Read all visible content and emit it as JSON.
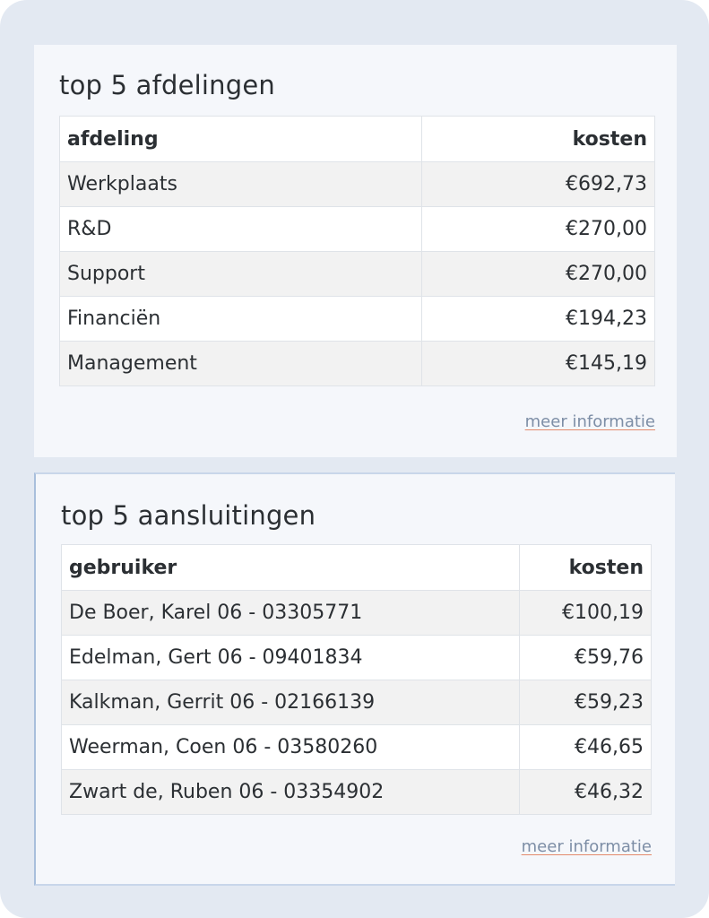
{
  "departments": {
    "title": "top 5 afdelingen",
    "columns": [
      "afdeling",
      "kosten"
    ],
    "rows": [
      {
        "name": "Werkplaats",
        "cost": "€692,73"
      },
      {
        "name": "R&D",
        "cost": "€270,00"
      },
      {
        "name": "Support",
        "cost": "€270,00"
      },
      {
        "name": "Financiën",
        "cost": "€194,23"
      },
      {
        "name": "Management",
        "cost": "€145,19"
      }
    ],
    "more_link": "meer informatie"
  },
  "connections": {
    "title": "top 5 aansluitingen",
    "columns": [
      "gebruiker",
      "kosten"
    ],
    "rows": [
      {
        "name": "De Boer, Karel 06 - 03305771",
        "cost": "€100,19"
      },
      {
        "name": "Edelman, Gert 06 - 09401834",
        "cost": "€59,76"
      },
      {
        "name": "Kalkman, Gerrit 06 - 02166139",
        "cost": "€59,23"
      },
      {
        "name": "Weerman, Coen 06 - 03580260",
        "cost": "€46,65"
      },
      {
        "name": "Zwart de, Ruben 06 - 03354902",
        "cost": "€46,32"
      }
    ],
    "more_link": "meer informatie"
  },
  "colors": {
    "background": "#e3e9f2",
    "card": "#f5f7fb",
    "link": "#7d8ea6",
    "link_underline": "#e38a6d"
  }
}
